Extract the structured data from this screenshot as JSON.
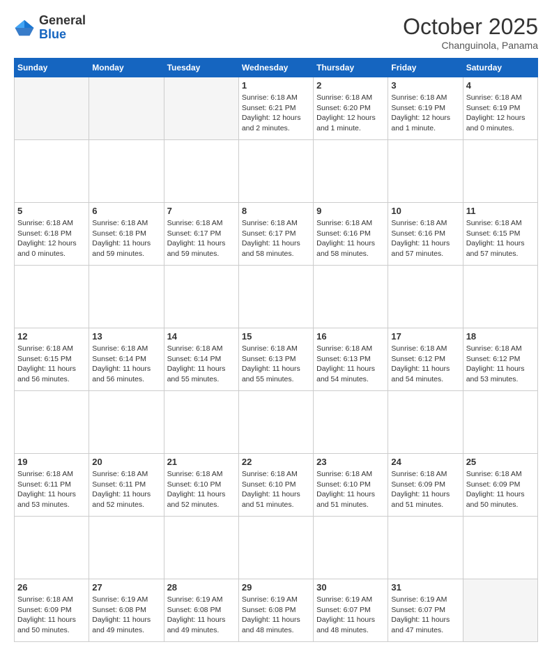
{
  "logo": {
    "general": "General",
    "blue": "Blue"
  },
  "header": {
    "month": "October 2025",
    "location": "Changuinola, Panama"
  },
  "weekdays": [
    "Sunday",
    "Monday",
    "Tuesday",
    "Wednesday",
    "Thursday",
    "Friday",
    "Saturday"
  ],
  "weeks": [
    [
      {
        "day": "",
        "info": ""
      },
      {
        "day": "",
        "info": ""
      },
      {
        "day": "",
        "info": ""
      },
      {
        "day": "1",
        "info": "Sunrise: 6:18 AM\nSunset: 6:21 PM\nDaylight: 12 hours\nand 2 minutes."
      },
      {
        "day": "2",
        "info": "Sunrise: 6:18 AM\nSunset: 6:20 PM\nDaylight: 12 hours\nand 1 minute."
      },
      {
        "day": "3",
        "info": "Sunrise: 6:18 AM\nSunset: 6:19 PM\nDaylight: 12 hours\nand 1 minute."
      },
      {
        "day": "4",
        "info": "Sunrise: 6:18 AM\nSunset: 6:19 PM\nDaylight: 12 hours\nand 0 minutes."
      }
    ],
    [
      {
        "day": "5",
        "info": "Sunrise: 6:18 AM\nSunset: 6:18 PM\nDaylight: 12 hours\nand 0 minutes."
      },
      {
        "day": "6",
        "info": "Sunrise: 6:18 AM\nSunset: 6:18 PM\nDaylight: 11 hours\nand 59 minutes."
      },
      {
        "day": "7",
        "info": "Sunrise: 6:18 AM\nSunset: 6:17 PM\nDaylight: 11 hours\nand 59 minutes."
      },
      {
        "day": "8",
        "info": "Sunrise: 6:18 AM\nSunset: 6:17 PM\nDaylight: 11 hours\nand 58 minutes."
      },
      {
        "day": "9",
        "info": "Sunrise: 6:18 AM\nSunset: 6:16 PM\nDaylight: 11 hours\nand 58 minutes."
      },
      {
        "day": "10",
        "info": "Sunrise: 6:18 AM\nSunset: 6:16 PM\nDaylight: 11 hours\nand 57 minutes."
      },
      {
        "day": "11",
        "info": "Sunrise: 6:18 AM\nSunset: 6:15 PM\nDaylight: 11 hours\nand 57 minutes."
      }
    ],
    [
      {
        "day": "12",
        "info": "Sunrise: 6:18 AM\nSunset: 6:15 PM\nDaylight: 11 hours\nand 56 minutes."
      },
      {
        "day": "13",
        "info": "Sunrise: 6:18 AM\nSunset: 6:14 PM\nDaylight: 11 hours\nand 56 minutes."
      },
      {
        "day": "14",
        "info": "Sunrise: 6:18 AM\nSunset: 6:14 PM\nDaylight: 11 hours\nand 55 minutes."
      },
      {
        "day": "15",
        "info": "Sunrise: 6:18 AM\nSunset: 6:13 PM\nDaylight: 11 hours\nand 55 minutes."
      },
      {
        "day": "16",
        "info": "Sunrise: 6:18 AM\nSunset: 6:13 PM\nDaylight: 11 hours\nand 54 minutes."
      },
      {
        "day": "17",
        "info": "Sunrise: 6:18 AM\nSunset: 6:12 PM\nDaylight: 11 hours\nand 54 minutes."
      },
      {
        "day": "18",
        "info": "Sunrise: 6:18 AM\nSunset: 6:12 PM\nDaylight: 11 hours\nand 53 minutes."
      }
    ],
    [
      {
        "day": "19",
        "info": "Sunrise: 6:18 AM\nSunset: 6:11 PM\nDaylight: 11 hours\nand 53 minutes."
      },
      {
        "day": "20",
        "info": "Sunrise: 6:18 AM\nSunset: 6:11 PM\nDaylight: 11 hours\nand 52 minutes."
      },
      {
        "day": "21",
        "info": "Sunrise: 6:18 AM\nSunset: 6:10 PM\nDaylight: 11 hours\nand 52 minutes."
      },
      {
        "day": "22",
        "info": "Sunrise: 6:18 AM\nSunset: 6:10 PM\nDaylight: 11 hours\nand 51 minutes."
      },
      {
        "day": "23",
        "info": "Sunrise: 6:18 AM\nSunset: 6:10 PM\nDaylight: 11 hours\nand 51 minutes."
      },
      {
        "day": "24",
        "info": "Sunrise: 6:18 AM\nSunset: 6:09 PM\nDaylight: 11 hours\nand 51 minutes."
      },
      {
        "day": "25",
        "info": "Sunrise: 6:18 AM\nSunset: 6:09 PM\nDaylight: 11 hours\nand 50 minutes."
      }
    ],
    [
      {
        "day": "26",
        "info": "Sunrise: 6:18 AM\nSunset: 6:09 PM\nDaylight: 11 hours\nand 50 minutes."
      },
      {
        "day": "27",
        "info": "Sunrise: 6:19 AM\nSunset: 6:08 PM\nDaylight: 11 hours\nand 49 minutes."
      },
      {
        "day": "28",
        "info": "Sunrise: 6:19 AM\nSunset: 6:08 PM\nDaylight: 11 hours\nand 49 minutes."
      },
      {
        "day": "29",
        "info": "Sunrise: 6:19 AM\nSunset: 6:08 PM\nDaylight: 11 hours\nand 48 minutes."
      },
      {
        "day": "30",
        "info": "Sunrise: 6:19 AM\nSunset: 6:07 PM\nDaylight: 11 hours\nand 48 minutes."
      },
      {
        "day": "31",
        "info": "Sunrise: 6:19 AM\nSunset: 6:07 PM\nDaylight: 11 hours\nand 47 minutes."
      },
      {
        "day": "",
        "info": ""
      }
    ]
  ]
}
